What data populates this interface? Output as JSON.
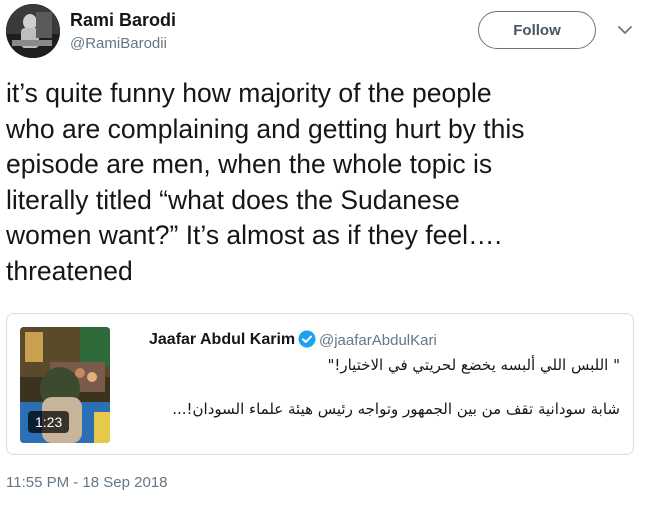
{
  "author": {
    "name": "Rami Barodi",
    "handle": "@RamiBarodii"
  },
  "follow_label": "Follow",
  "tweet": {
    "text": "it’s quite funny how majority of the people\nwho are complaining and getting hurt by this\nepisode are men, when the whole topic is\nliterally titled “what does the Sudanese\nwomen want?” It’s almost as if they feel….\nthreatened",
    "timestamp": "11:55 PM - 18 Sep 2018"
  },
  "quoted": {
    "name": "Jaafar Abdul Karim",
    "handle": "@jaafarAbdulKari",
    "line1": "\" اللبس اللي ألبسه يخضع لحريتي في الاختيار!\"",
    "line2": "شابة سودانية تقف من بين الجمهور وتواجه رئيس هيئة علماء السودان!...",
    "video_duration": "1:23"
  },
  "colors": {
    "text": "#14171a",
    "secondary": "#657786",
    "verified": "#1da1f2",
    "border": "#d6dde3"
  },
  "icons": [
    "avatar-photo",
    "chevron-down-icon",
    "verified-badge-icon",
    "video-thumbnail"
  ]
}
